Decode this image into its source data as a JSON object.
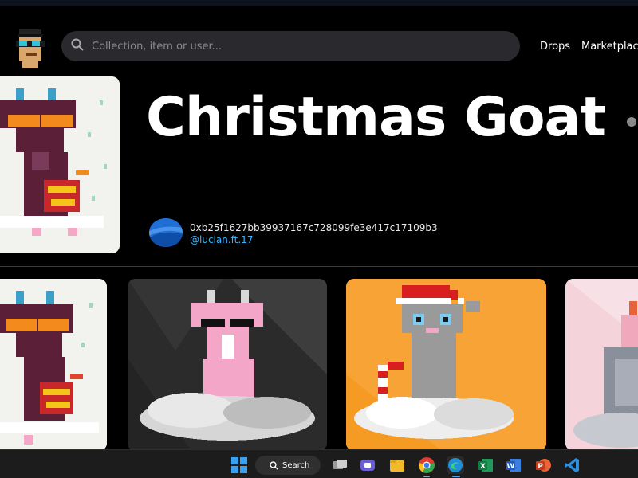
{
  "header": {
    "search": {
      "placeholder": "Collection, item or user...",
      "value": ""
    },
    "nav": {
      "drops": "Drops",
      "marketplace": "Marketplace"
    },
    "logo_icon": "pixel-punk-avatar-icon"
  },
  "hero": {
    "title": "Christmas Goat",
    "owner_address": "0xb25f1627bb39937167c728099fe3e417c17109b3",
    "owner_handle": "@lucian.ft.17",
    "accent_color": "#39b6ff"
  },
  "gallery": {
    "items": [
      {
        "icon": "goat-orange-glasses-icon",
        "background": "#f2f3ef"
      },
      {
        "icon": "goat-pink-cloud-icon",
        "background": "#2b2b2b"
      },
      {
        "icon": "goat-santa-hat-icon",
        "background": "#f7a335"
      },
      {
        "icon": "goat-pink-partial-icon",
        "background": "#f4d3db"
      }
    ]
  },
  "taskbar": {
    "search_label": "Search",
    "apps": [
      "windows-start-icon",
      "search-icon",
      "task-view-icon",
      "teams-icon",
      "file-explorer-icon",
      "chrome-icon",
      "edge-icon",
      "excel-icon",
      "word-icon",
      "powerpoint-icon",
      "vscode-icon"
    ]
  }
}
